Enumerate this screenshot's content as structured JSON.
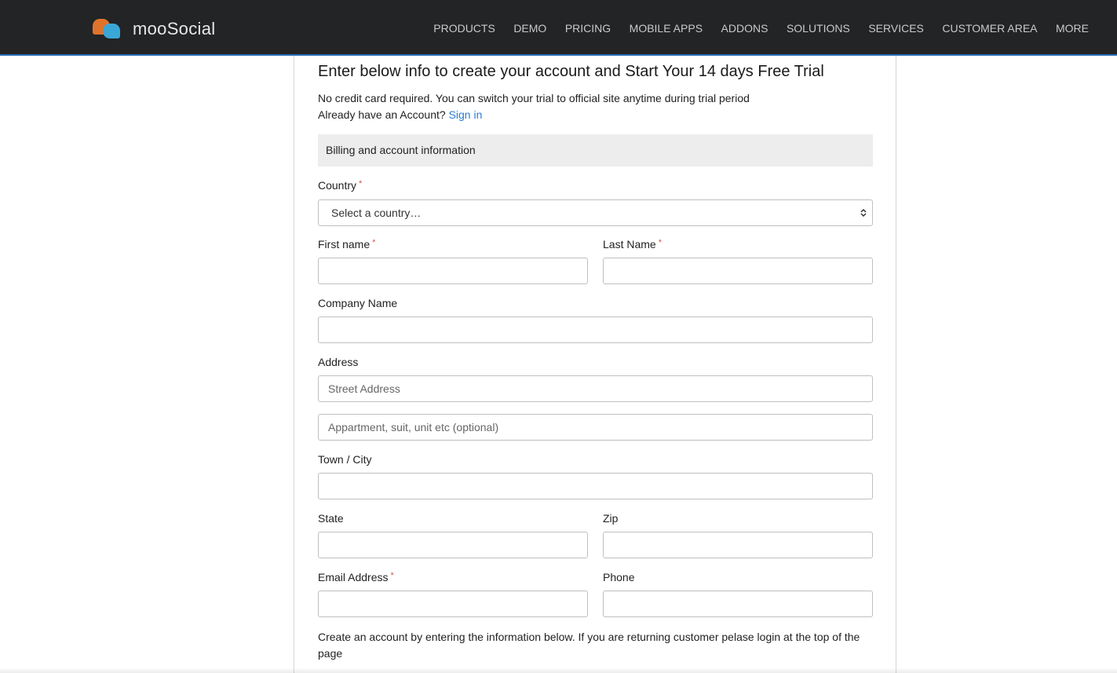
{
  "brand": {
    "name": "mooSocial",
    "logo_colors": [
      "#e0732b",
      "#3ba7d6"
    ]
  },
  "nav": {
    "items": [
      {
        "label": "PRODUCTS"
      },
      {
        "label": "DEMO"
      },
      {
        "label": "PRICING"
      },
      {
        "label": "MOBILE APPS"
      },
      {
        "label": "ADDONS"
      },
      {
        "label": "SOLUTIONS"
      },
      {
        "label": "SERVICES"
      },
      {
        "label": "CUSTOMER AREA"
      },
      {
        "label": "MORE"
      }
    ]
  },
  "main": {
    "title": "Enter below info to create your account and Start Your 14 days Free Trial",
    "intro_line1": "No credit card required. You can switch your trial to official site anytime during trial period",
    "intro_line2": "Already have an Account?",
    "signin_link": "Sign in",
    "section_header": "Billing and account information",
    "footer_note": "Create an account by entering the information below. If you are returning customer pelase login at the top of the page"
  },
  "form": {
    "country": {
      "label": "Country",
      "required_mark": "*",
      "selected": "Select a country…"
    },
    "first_name": {
      "label": "First name",
      "required_mark": "*",
      "value": ""
    },
    "last_name": {
      "label": "Last Name",
      "required_mark": "*",
      "value": ""
    },
    "company": {
      "label": "Company Name",
      "value": ""
    },
    "address": {
      "label": "Address",
      "street_placeholder": "Street Address",
      "apt_placeholder": "Appartment, suit, unit etc (optional)"
    },
    "city": {
      "label": "Town / City",
      "value": ""
    },
    "state": {
      "label": "State",
      "value": ""
    },
    "zip": {
      "label": "Zip",
      "value": ""
    },
    "email": {
      "label": "Email Address",
      "required_mark": "*",
      "value": ""
    },
    "phone": {
      "label": "Phone",
      "value": ""
    }
  },
  "colors": {
    "navbar_bg": "#222426",
    "link": "#2b7bd3",
    "required": "#d9534f",
    "section_bg": "#ededed"
  }
}
